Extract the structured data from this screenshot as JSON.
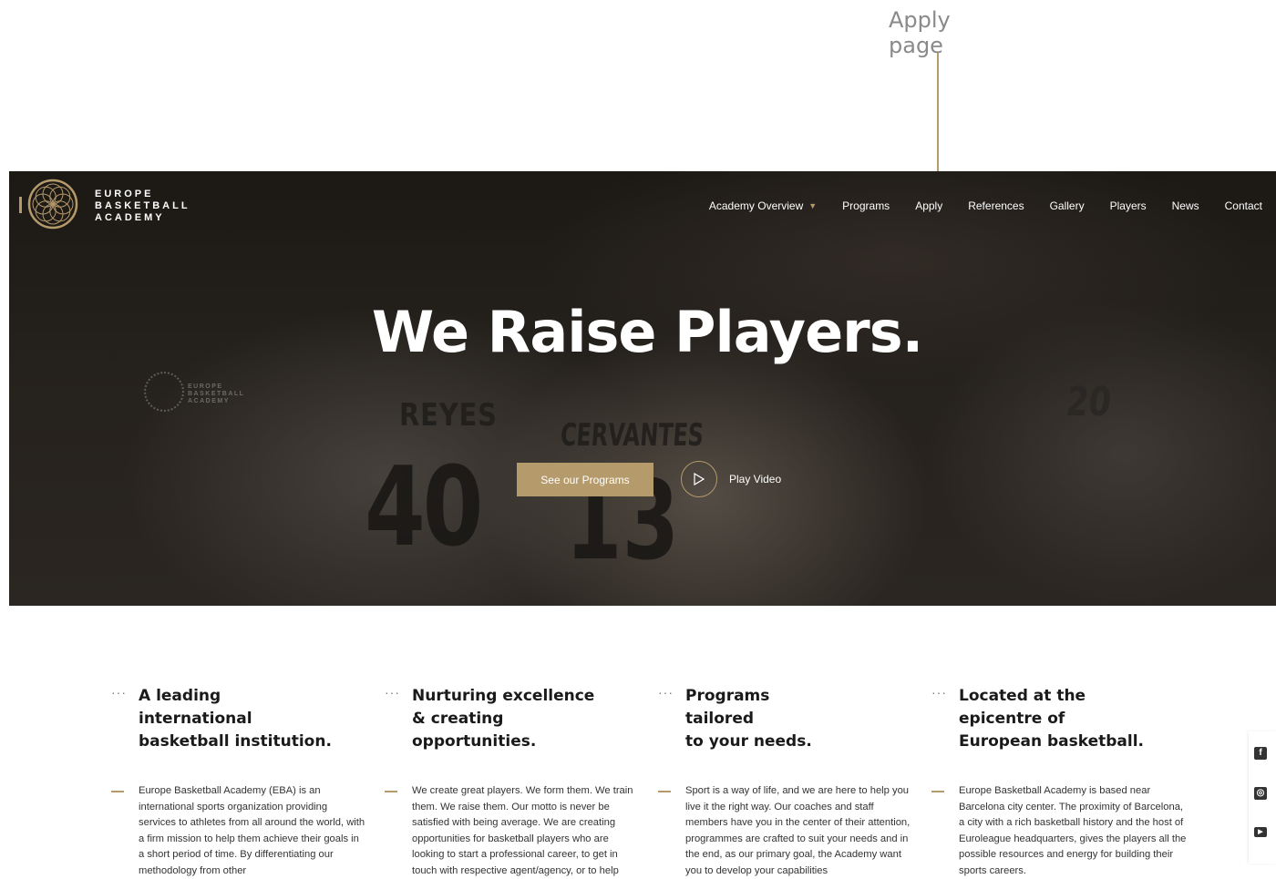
{
  "annotation": {
    "label": "Apply page",
    "line_color": "#b59a6b"
  },
  "header": {
    "logo": {
      "line1": "EUROPE",
      "line2": "BASKETBALL",
      "line3": "ACADEMY",
      "icon": "ornamental-ring-logo"
    },
    "nav": [
      {
        "label": "Academy Overview",
        "has_dropdown": true
      },
      {
        "label": "Programs"
      },
      {
        "label": "Apply"
      },
      {
        "label": "References"
      },
      {
        "label": "Gallery"
      },
      {
        "label": "Players"
      },
      {
        "label": "News"
      },
      {
        "label": "Contact"
      }
    ],
    "dropdown_caret": "▼"
  },
  "hero": {
    "headline": "We Raise Players.",
    "cta_label": "See our Programs",
    "video_label": "Play Video",
    "photo_text": {
      "jersey1_name": "REYES",
      "jersey1_number": "40",
      "jersey2_name": "CERVANTES",
      "jersey2_number": "13",
      "jersey3_number": "20",
      "shirt_logo": "EUROPE BASKETBALL ACADEMY"
    }
  },
  "features": [
    {
      "dots": "···",
      "title": "A leading\ninternational\nbasketball institution.",
      "body": "Europe Basketball Academy (EBA) is an international sports organization providing services to athletes from all around the world, with a firm mission to help them achieve their goals in a short period of time. By differentiating our methodology from other"
    },
    {
      "dots": "···",
      "title": "Nurturing excellence\n& creating\nopportunities.",
      "body": "We create great players. We form them. We train them. We raise them. Our motto is never be satisfied with being average. We are creating opportunities for basketball players who are looking to start a professional career, to get in touch with respective agent/agency, or to help"
    },
    {
      "dots": "···",
      "title": "Programs\ntailored\nto your needs.",
      "body": "Sport is a way of life, and we are here to help you live it the right way. Our coaches and staff members have you in the center of their attention, programmes are crafted to suit your needs and in the end, as our primary goal, the Academy want you to develop your capabilities"
    },
    {
      "dots": "···",
      "title": "Located at the\nepicentre of\nEuropean basketball.",
      "body": "Europe Basketball Academy is based near Barcelona city center. The proximity of Barcelona, a city with a rich basketball history and the host of Euroleague headquarters, gives the players all the possible resources and energy for building their sports careers."
    }
  ],
  "social": [
    {
      "icon": "facebook-icon",
      "glyph": "f"
    },
    {
      "icon": "instagram-icon",
      "glyph": "◎"
    },
    {
      "icon": "youtube-icon",
      "glyph": "▶"
    }
  ],
  "colors": {
    "accent": "#b59a6b",
    "hero_overlay": "#1c1915",
    "text_dark": "#1a1a1a"
  }
}
